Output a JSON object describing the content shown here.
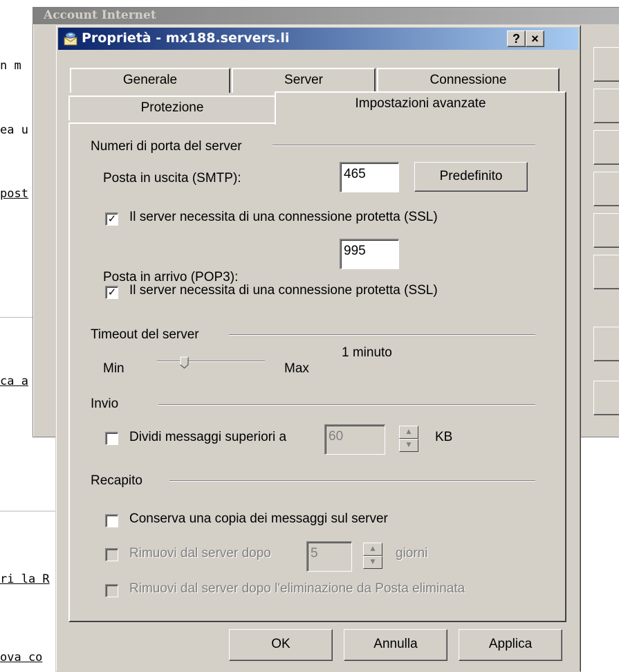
{
  "background": {
    "window_title": "Account Internet",
    "snippets": [
      "n m",
      "ea u",
      "post",
      "ca a",
      "ri la R",
      "ova co"
    ]
  },
  "dialog": {
    "title": "Proprietà - mx188.servers.li",
    "help_button": "?",
    "close_button": "×",
    "tabs_row1": [
      "Generale",
      "Server",
      "Connessione"
    ],
    "tabs_row2": [
      "Protezione",
      "Impostazioni avanzate"
    ],
    "active_tab": "Impostazioni avanzate",
    "ports": {
      "group_label": "Numeri di porta del server",
      "smtp_label": "Posta in uscita (SMTP):",
      "smtp_value": "465",
      "default_button": "Predefinito",
      "smtp_ssl_label": "Il server necessita di una connessione protetta (SSL)",
      "smtp_ssl_checked": true,
      "pop3_label": "Posta in arrivo (POP3):",
      "pop3_value": "995",
      "pop3_ssl_label": "Il server necessita di una connessione protetta (SSL)",
      "pop3_ssl_checked": true
    },
    "timeout": {
      "group_label": "Timeout del server",
      "min_label": "Min",
      "max_label": "Max",
      "value_label": "1 minuto",
      "slider_fraction": 0.2
    },
    "sending": {
      "group_label": "Invio",
      "split_label": "Dividi messaggi superiori a",
      "split_checked": false,
      "split_value": "60",
      "unit": "KB"
    },
    "delivery": {
      "group_label": "Recapito",
      "keep_copy_label": "Conserva una copia dei messaggi sul server",
      "keep_copy_checked": false,
      "remove_after_label": "Rimuovi dal server dopo",
      "remove_after_value": "5",
      "days_label": "giorni",
      "remove_deleted_label": "Rimuovi dal server dopo l'eliminazione da Posta eliminata"
    },
    "buttons": {
      "ok": "OK",
      "cancel": "Annulla",
      "apply": "Applica"
    }
  }
}
